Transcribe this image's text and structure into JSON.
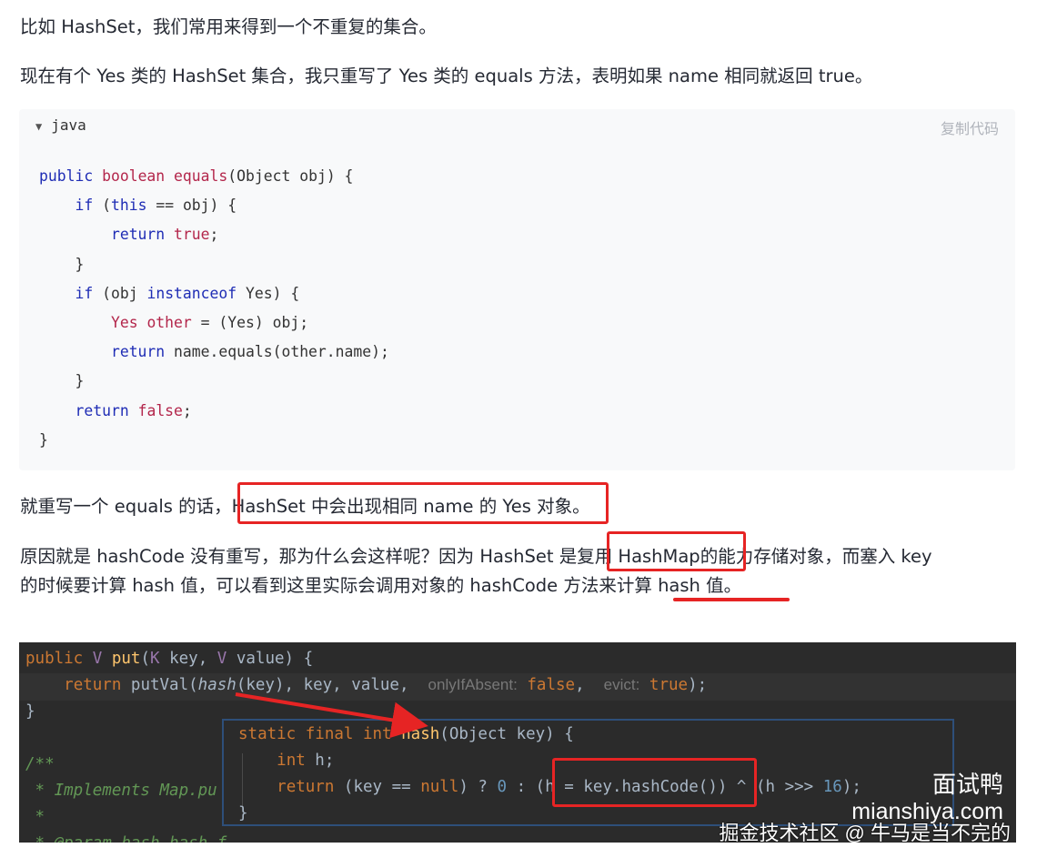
{
  "paragraphs": {
    "p1": "比如 HashSet，我们常用来得到一个不重复的集合。",
    "p2": "现在有个 Yes 类的 HashSet 集合，我只重写了 Yes 类的 equals 方法，表明如果 name 相同就返回 true。",
    "p3_prefix": "就重写一个 equals 的话，",
    "p3_highlight": "HashSet 中会出现相同 name 的 Yes 对象。",
    "p4_prefix": "原因就是 hashCode 没有重写，那为什么会这样呢？因为 HashSet 是",
    "p4_highlight": "复用 HashMap",
    "p4_suffix": "的能力存储对象，而塞入 key",
    "p5_prefix": "的时候要计算 hash 值，可以看到这里实际会调用对象的 hashCode 方法来计算",
    "p5_underline": " hash 值。"
  },
  "code_block": {
    "language": "java",
    "collapse_icon": "triangle-down-icon",
    "copy_label": "复制代码"
  },
  "ide": {
    "popup_signature_text": "static final int hash(Object key) {",
    "hint_onlyIfAbsent": "onlyIfAbsent:",
    "hint_evict": "evict:",
    "comment_1": "/**",
    "comment_2": " * Implements Map.pu",
    "comment_3": " *",
    "comment_4": " * @param hash hash f"
  },
  "watermark": {
    "line1": "面试鸭",
    "line2": "mianshiya.com",
    "line3": "掘金技术社区 @ 牛马是当不完的"
  },
  "colors": {
    "annotation_red": "#e62424",
    "ide_background": "#2b2b2b",
    "code_background": "#f8f9fa"
  }
}
